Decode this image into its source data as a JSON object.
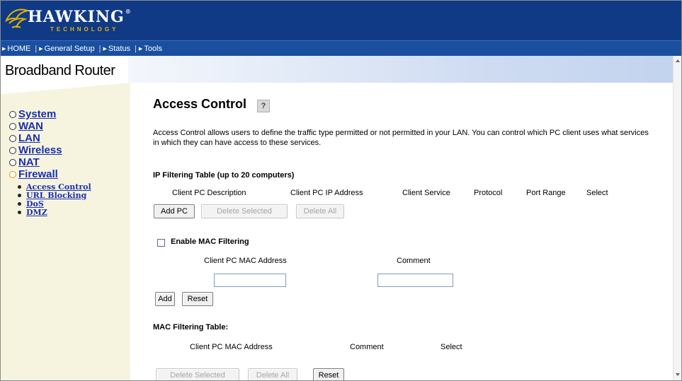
{
  "brand": {
    "name": "HAWKING",
    "registered": "®",
    "subtitle": "TECHNOLOGY",
    "colors": {
      "banner": "#103a86",
      "navbar": "#1a4fa0",
      "accent": "#e1b400",
      "link": "#1a2fb0"
    }
  },
  "nav": {
    "items": [
      {
        "label": "HOME",
        "icon": "triangle-right-icon"
      },
      {
        "label": "General Setup",
        "icon": "triangle-right-icon"
      },
      {
        "label": "Status",
        "icon": "triangle-right-icon"
      },
      {
        "label": "Tools",
        "icon": "triangle-right-icon"
      }
    ],
    "separator": "|"
  },
  "sidebar": {
    "title": "Broadband Router",
    "items": [
      {
        "label": "System"
      },
      {
        "label": "WAN"
      },
      {
        "label": "LAN"
      },
      {
        "label": "Wireless"
      },
      {
        "label": "NAT"
      },
      {
        "label": "Firewall",
        "active": true
      }
    ],
    "subitems": [
      {
        "label": "Access Control"
      },
      {
        "label": "URL Blocking"
      },
      {
        "label": "DoS"
      },
      {
        "label": "DMZ"
      }
    ]
  },
  "content": {
    "title": "Access Control",
    "help_icon": "help-icon",
    "help_glyph": "?",
    "description": "Access Control allows users to define the traffic type permitted or not permitted in your LAN. You can control which PC client uses what services in which they can have access to these services.",
    "ip_table": {
      "title": "IP Filtering Table (up to 20 computers)",
      "columns": [
        "Client PC Description",
        "Client PC IP Address",
        "Client Service",
        "Protocol",
        "Port Range",
        "Select"
      ],
      "buttons": {
        "add": "Add PC",
        "delete_selected": "Delete Selected",
        "delete_all": "Delete All"
      }
    },
    "mac_filter": {
      "checkbox_label": "Enable MAC Filtering",
      "checked": false,
      "columns": [
        "Client PC MAC Address",
        "Comment"
      ],
      "mac_value": "",
      "comment_value": "",
      "buttons": {
        "add": "Add",
        "reset": "Reset"
      }
    },
    "mac_table": {
      "title": "MAC Filtering Table:",
      "columns": [
        "Client PC MAC Address",
        "Comment",
        "Select"
      ],
      "buttons": {
        "delete_selected": "Delete Selected",
        "delete_all": "Delete All",
        "reset": "Reset"
      }
    }
  }
}
